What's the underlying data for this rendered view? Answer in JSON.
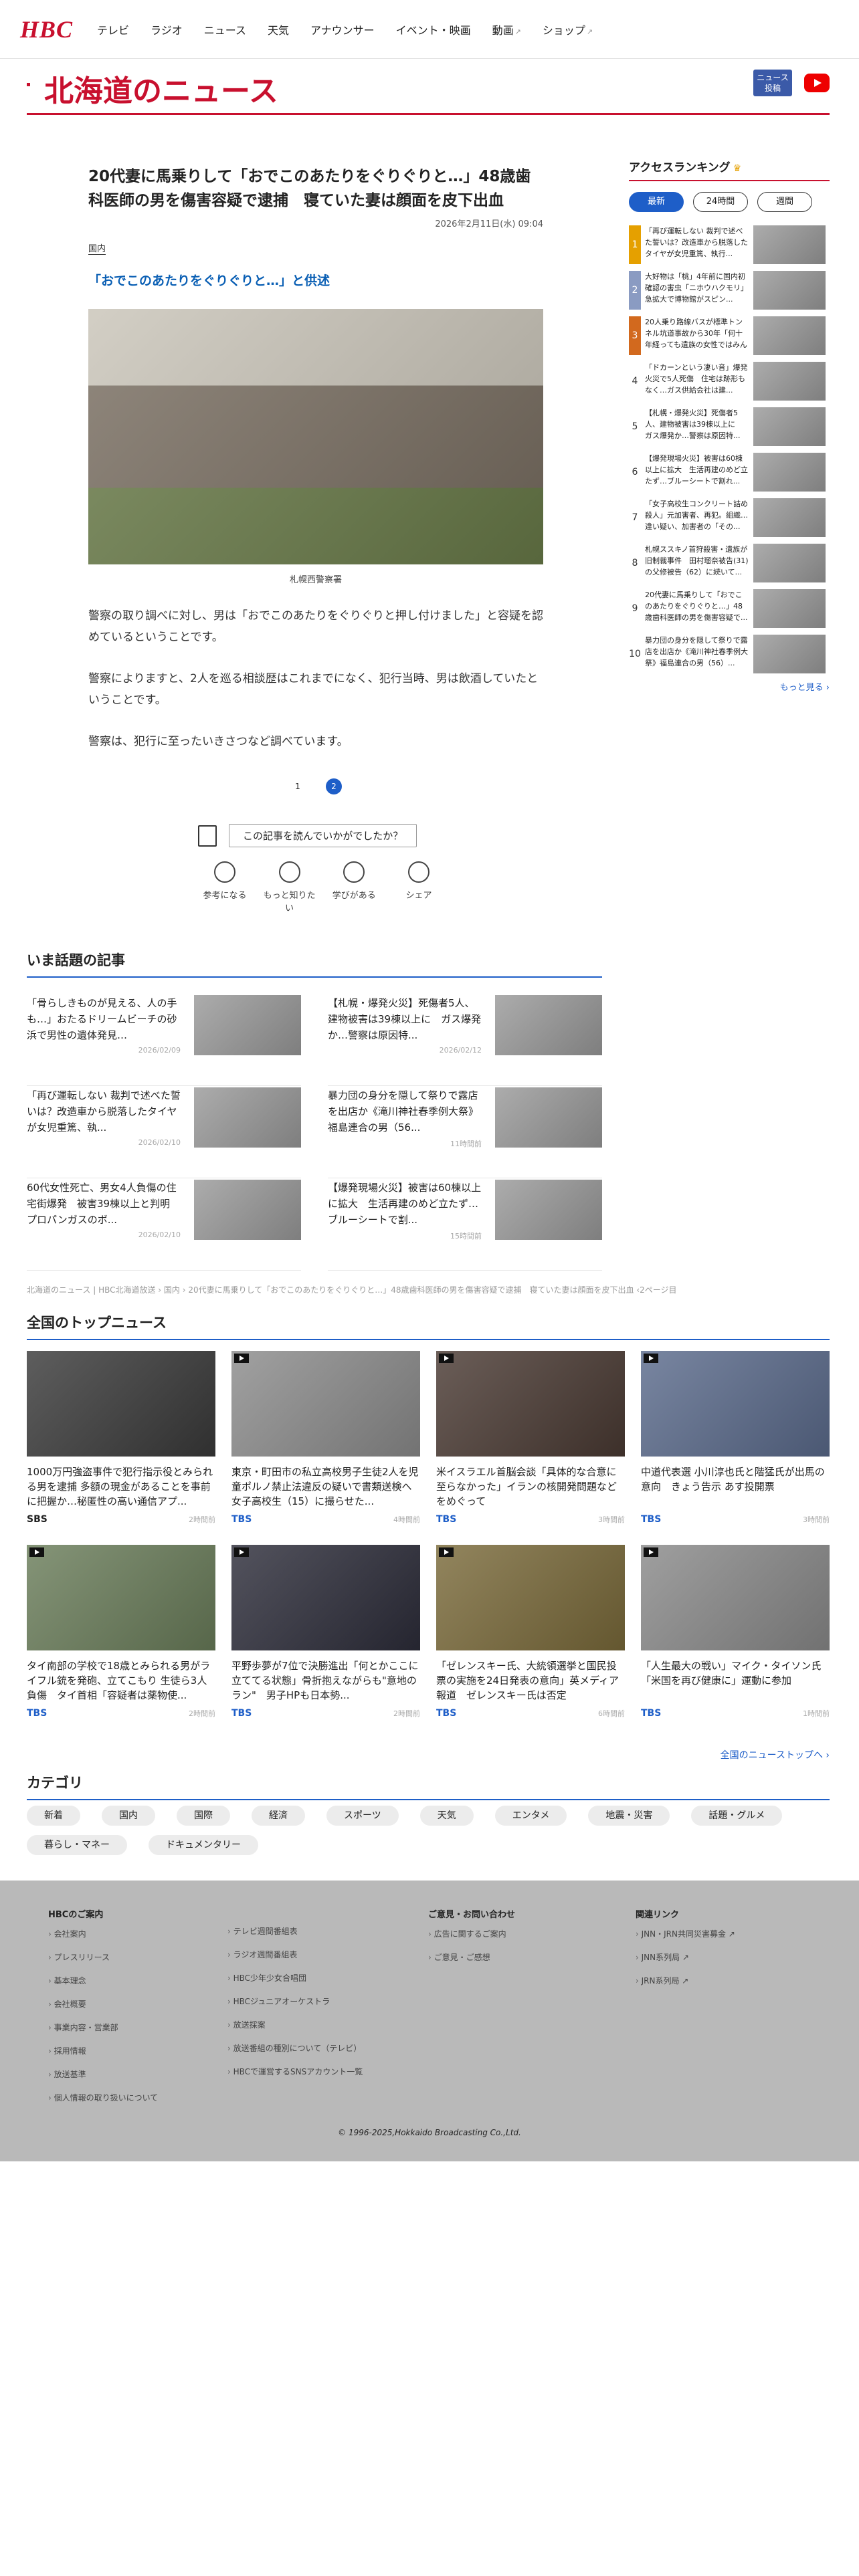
{
  "header": {
    "logo": "HBC",
    "nav": [
      {
        "label": "テレビ",
        "ext": ""
      },
      {
        "label": "ラジオ",
        "ext": ""
      },
      {
        "label": "ニュース",
        "ext": ""
      },
      {
        "label": "天気",
        "ext": ""
      },
      {
        "label": "アナウンサー",
        "ext": ""
      },
      {
        "label": "イベント・映画",
        "ext": ""
      },
      {
        "label": "動画",
        "ext": "↗"
      },
      {
        "label": "ショップ",
        "ext": "↗"
      }
    ]
  },
  "section": {
    "title": "北海道のニュース",
    "news_button": "ニュース\n投稿"
  },
  "article": {
    "title": "20代妻に馬乗りして「おでこのあたりをぐりぐりと…」48歳歯科医師の男を傷害容疑で逮捕　寝ていた妻は顔面を皮下出血",
    "date": "2026年2月11日(水) 09:04",
    "category": "国内",
    "related": "「おでこのあたりをぐりぐりと…」と供述",
    "photo_caption": "札幌西警察署",
    "paragraphs": [
      "警察の取り調べに対し、男は「おでこのあたりをぐりぐりと押し付けました」と容疑を認めているということです。",
      "警察によりますと、2人を巡る相談歴はこれまでになく、犯行当時、男は飲酒していたということです。",
      "警察は、犯行に至ったいきさつなど調べています。"
    ],
    "pages": [
      "1",
      "2"
    ],
    "survey_question": "この記事を読んでいかがでしたか？",
    "reactions": [
      "参考になる",
      "もっと知りたい",
      "学びがある",
      "シェア"
    ]
  },
  "ranking": {
    "title": "アクセスランキング",
    "tabs": [
      "最新",
      "24時間",
      "週間"
    ],
    "items": [
      {
        "n": "1",
        "t": "「再び運転しない 裁判で述べた誓いは？改造車から脱落したタイヤが女児重篤、執行..."
      },
      {
        "n": "2",
        "t": "大好物は「桃」4年前に国内初確認の害虫「ニホウハクモリ」急拡大で博物館がスピン..."
      },
      {
        "n": "3",
        "t": "20人乗り路線バスが標準トンネル坑道事故から30年「何十年経っても遺族の女性ではみんな同..."
      },
      {
        "n": "4",
        "t": "「ドカーンという凄い音」爆発火災で5人死傷　住宅は跡形もなく…ガス供給会社は建..."
      },
      {
        "n": "5",
        "t": "【札幌・爆発火災】死傷者5人、建物被害は39棟以上に　ガス爆発か…警察は原因特..."
      },
      {
        "n": "6",
        "t": "【爆発現場火災】被害は60棟以上に拡大　生活再建のめど立たず…ブルーシートで割れ..."
      },
      {
        "n": "7",
        "t": "「女子高校生コンクリート詰め殺人」元加害者、再犯。組織…違い疑い、加害者の「その..."
      },
      {
        "n": "8",
        "t": "札幌ススキノ首狩殺害・遺族が旧制裁事件　田村瑠奈被告(31)の父修被告（62）に続いて..."
      },
      {
        "n": "9",
        "t": "20代妻に馬乗りして「おでこのあたりをぐりぐりと…」48歳歯科医師の男を傷害容疑で..."
      },
      {
        "n": "10",
        "t": "暴力団の身分を隠して祭りで露店を出店か《滝川神社春季例大祭》福島連合の男（56）..."
      }
    ],
    "more": "もっと見る ›"
  },
  "trending": {
    "title": "いま話題の記事",
    "items": [
      {
        "t": "「骨らしきものが見える、人の手も…」おたるドリームビーチの砂浜で男性の遺体発見…",
        "time": "2026/02/09"
      },
      {
        "t": "【札幌・爆発火災】死傷者5人、建物被害は39棟以上に　ガス爆発か…警察は原因特...",
        "time": "2026/02/12"
      },
      {
        "t": "「再び運転しない 裁判で述べた誓いは？改造車から脱落したタイヤが女児重篤、執...",
        "time": "2026/02/10"
      },
      {
        "t": "暴力団の身分を隠して祭りで露店を出店か《滝川神社春季例大祭》福島連合の男（56...",
        "time": "11時間前"
      },
      {
        "t": "60代女性死亡、男女4人負傷の住宅街爆発　被害39棟以上と判明　プロパンガスのボ...",
        "time": "2026/02/10"
      },
      {
        "t": "【爆発現場火災】被害は60棟以上に拡大　生活再建のめど立たず…ブルーシートで割...",
        "time": "15時間前"
      }
    ]
  },
  "breadcrumb": "北海道のニュース | HBC北海道放送 › 国内 › 20代妻に馬乗りして「おでこのあたりをぐりぐりと…」48歳歯科医師の男を傷害容疑で逮捕　寝ていた妻は顔面を皮下出血 ‹2ページ目",
  "national": {
    "title": "全国のトップニュース",
    "items": [
      {
        "t": "1000万円強盗事件で犯行指示役とみられる男を逮捕 多額の現金があることを事前に把握か…秘匿性の高い通信アプ...",
        "src": "SBS",
        "time": "2時間前",
        "video": false
      },
      {
        "t": "東京・町田市の私立高校男子生徒2人を児童ポルノ禁止法違反の疑いで書類送検へ　女子高校生（15）に撮らせた...",
        "src": "TBS",
        "time": "4時間前",
        "video": true
      },
      {
        "t": "米イスラエル首脳会談「具体的な合意に至らなかった」イランの核開発問題などをめぐって",
        "src": "TBS",
        "time": "3時間前",
        "video": true
      },
      {
        "t": "中道代表選 小川淳也氏と階猛氏が出馬の意向　きょう告示 あす投開票",
        "src": "TBS",
        "time": "3時間前",
        "video": true
      },
      {
        "t": "タイ南部の学校で18歳とみられる男がライフル銃を発砲、立てこもり 生徒ら3人負傷　タイ首相「容疑者は薬物使...",
        "src": "TBS",
        "time": "2時間前",
        "video": true
      },
      {
        "t": "平野歩夢が7位で決勝進出「何とかここに立ててる状態」骨折抱えながらも\"意地のラン\"　男子HPも日本勢...",
        "src": "TBS",
        "time": "2時間前",
        "video": true
      },
      {
        "t": "「ゼレンスキー氏、大統領選挙と国民投票の実施を24日発表の意向」英メディア報道　ゼレンスキー氏は否定",
        "src": "TBS",
        "time": "6時間前",
        "video": true
      },
      {
        "t": "「人生最大の戦い」マイク・タイソン氏「米国を再び健康に」運動に参加",
        "src": "TBS",
        "time": "1時間前",
        "video": true
      }
    ],
    "more": "全国のニューストップへ ›"
  },
  "categories": {
    "title": "カテゴリ",
    "items": [
      "新着",
      "国内",
      "国際",
      "経済",
      "スポーツ",
      "天気",
      "エンタメ",
      "地震・災害",
      "話題・グルメ",
      "暮らし・マネー",
      "ドキュメンタリー"
    ]
  },
  "footer": {
    "cols": [
      {
        "h": "HBCのご案内",
        "items": [
          "会社案内",
          "プレスリリース",
          "基本理念",
          "会社概要",
          "事業内容・営業部",
          "採用情報",
          "放送基準",
          "個人情報の取り扱いについて"
        ]
      },
      {
        "h": "",
        "items": [
          "テレビ週間番組表",
          "ラジオ週間番組表",
          "HBC少年少女合唱団",
          "HBCジュニアオーケストラ",
          "放送採案",
          "放送番組の種別について（テレビ）",
          "HBCで運営するSNSアカウント一覧"
        ]
      },
      {
        "h": "ご意見・お問い合わせ",
        "items": [
          "広告に関するご案内",
          "ご意見・ご感想"
        ]
      },
      {
        "h": "関連リンク",
        "items": [
          "JNN・JRN共同災害募金 ↗",
          "JNN系列局 ↗",
          "JRN系列局 ↗"
        ]
      }
    ],
    "copyright": "© 1996-2025,Hokkaido Broadcasting Co.,Ltd."
  },
  "colors": {
    "brand": "#c8102e",
    "accent": "#1e5ec8"
  }
}
